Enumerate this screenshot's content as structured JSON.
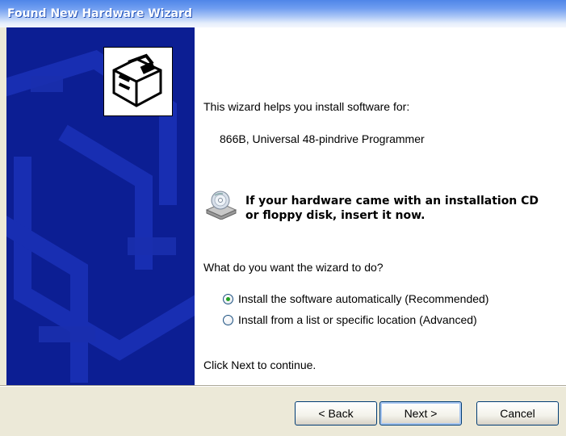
{
  "window": {
    "title": "Found New Hardware Wizard"
  },
  "intro": "This wizard helps you install software for:",
  "device": "866B, Universal 48-pindrive Programmer",
  "cd_prompt": {
    "line1": "If your hardware came with an installation CD",
    "line2": "or floppy disk, insert it now."
  },
  "question": "What do you want the wizard to do?",
  "options": [
    {
      "label": "Install the software automatically (Recommended)",
      "selected": true
    },
    {
      "label": "Install from a list or specific location (Advanced)",
      "selected": false
    }
  ],
  "footer_text": "Click Next to continue.",
  "buttons": {
    "back": "< Back",
    "next": "Next >",
    "cancel": "Cancel"
  },
  "colors": {
    "banner": "#0c1e93",
    "title_gradient_start": "#4f86e8",
    "radio_dot": "#21a121"
  },
  "icons": {
    "banner": "hardware-wizard-icon",
    "cd": "cd-drive-icon"
  }
}
